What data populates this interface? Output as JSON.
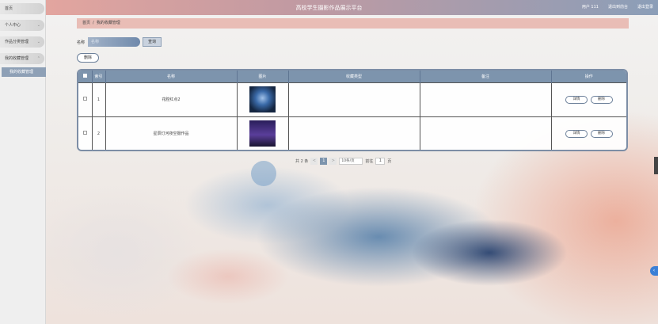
{
  "header": {
    "title": "高校学生摄影作品展示平台",
    "links": [
      "用户 111",
      "退出到前台",
      "退出登录"
    ]
  },
  "sidebar": {
    "items": [
      {
        "label": "首页"
      },
      {
        "label": "个人中心"
      },
      {
        "label": "作品分类管理"
      },
      {
        "label": "我的收藏管理"
      }
    ],
    "active_sub": "我的收藏管理"
  },
  "breadcrumb": {
    "home": "首页",
    "separator": "/",
    "current": "我的收藏管理"
  },
  "search": {
    "label": "名称",
    "placeholder": "名称",
    "button": "查询"
  },
  "toolbar": {
    "delete_label": "删除"
  },
  "table": {
    "headers": [
      "",
      "索引",
      "名称",
      "图片",
      "收藏类型",
      "备注",
      "操作"
    ],
    "rows": [
      {
        "index": "1",
        "name": "花腔红点2",
        "type": "",
        "note": "",
        "actions": [
          "详情",
          "删除"
        ]
      },
      {
        "index": "2",
        "name": "星辰灯河夜空摄作品",
        "type": "",
        "note": "",
        "actions": [
          "详情",
          "删除"
        ]
      }
    ]
  },
  "pagination": {
    "total": "共 2 条",
    "prev": "<",
    "current": "1",
    "next": ">",
    "page_size": "10条/页",
    "goto_label": "前往",
    "goto_value": "1",
    "page_suffix": "页"
  },
  "colors": {
    "accent": "#7d94ad",
    "header_start": "#e9a79e",
    "header_end": "#8b9eb8"
  }
}
